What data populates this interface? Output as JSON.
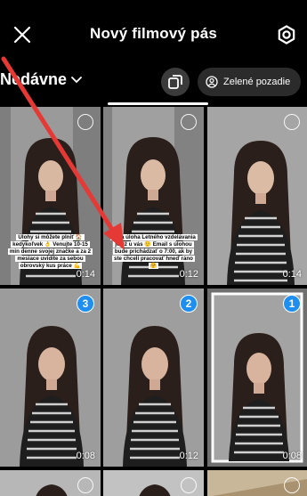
{
  "header": {
    "title": "Nový filmový pás",
    "close_icon": "close-icon",
    "settings_icon": "gear-icon"
  },
  "toolbar": {
    "album_label": "Nedávne",
    "green_screen_label": "Zelené pozadie"
  },
  "grid": {
    "rows": [
      [
        {
          "duration": "0:14",
          "selection": "",
          "caption": "Úlohy si môžete plniť 🏠 kedykoľvek 👌 Venujte 10-15 min denne svojej značke a za 2 mesiace uvidíte za sebou obrovský kus práce 💪"
        },
        {
          "duration": "0:12",
          "selection": "",
          "caption": "Prvá úloha Letného vzdelávania je už u vás 🙂 Email s úlohou bude prichádzať o 7:00, ak by ste chceli pracovať hneď ráno 🤗"
        },
        {
          "duration": "0:14",
          "selection": "",
          "caption": ""
        }
      ],
      [
        {
          "duration": "0:08",
          "selection": "3",
          "caption": ""
        },
        {
          "duration": "0:12",
          "selection": "2",
          "caption": ""
        },
        {
          "duration": "0:08",
          "selection": "1",
          "caption": ""
        }
      ]
    ]
  },
  "colors": {
    "background": "#000000",
    "accent_blue": "#1f8ef1",
    "annotation_arrow": "#e53935"
  }
}
